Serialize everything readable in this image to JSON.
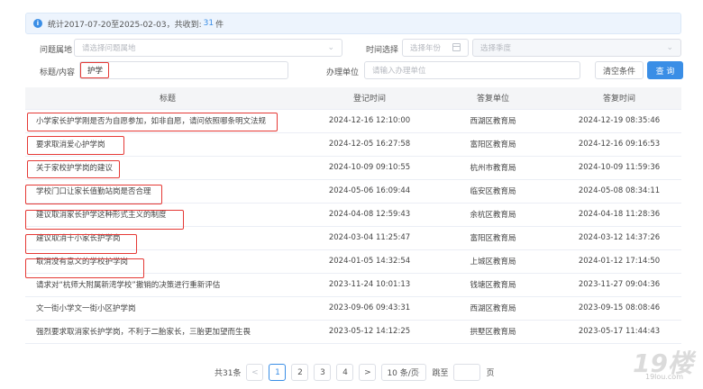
{
  "notice": {
    "prefix": "统计2017-07-20至2025-02-03，共收到:",
    "count": "31",
    "suffix": "件"
  },
  "filters": {
    "category_label": "问题属地",
    "category_placeholder": "请选择问题属地",
    "time_label": "时间选择",
    "year_placeholder": "选择年份",
    "season_placeholder": "选择季度",
    "title_label": "标题/内容",
    "title_value": "护学",
    "unit_label": "办理单位",
    "unit_placeholder": "请输入办理单位",
    "clear_label": "清空条件",
    "search_label": "查 询"
  },
  "table": {
    "headers": [
      "标题",
      "登记时间",
      "答复单位",
      "答复时间"
    ],
    "rows": [
      {
        "title": "小学家长护学刚是否为自愿参加，如非自愿，请问依照哪条明文法规",
        "reg": "2024-12-16 12:10:00",
        "unit": "西湖区教育局",
        "reply": "2024-12-19 08:35:46"
      },
      {
        "title": "要求取消爱心护学岗",
        "reg": "2024-12-05 16:27:58",
        "unit": "富阳区教育局",
        "reply": "2024-12-16 09:16:53"
      },
      {
        "title": "关于家校护学岗的建议",
        "reg": "2024-10-09 09:10:55",
        "unit": "杭州市教育局",
        "reply": "2024-10-09 11:59:36"
      },
      {
        "title": "学校门口让家长值勤站岗是否合理",
        "reg": "2024-05-06 16:09:44",
        "unit": "临安区教育局",
        "reply": "2024-05-08 08:34:11"
      },
      {
        "title": "建议取消家长护学这种形式主义的制度",
        "reg": "2024-04-08 12:59:43",
        "unit": "余杭区教育局",
        "reply": "2024-04-18 11:28:36"
      },
      {
        "title": "建议取消十小家长护学岗",
        "reg": "2024-03-04 11:25:47",
        "unit": "富阳区教育局",
        "reply": "2024-03-12 14:37:26"
      },
      {
        "title": "取消没有意义的学校护学岗",
        "reg": "2024-01-05 14:32:54",
        "unit": "上城区教育局",
        "reply": "2024-01-12 17:14:50"
      },
      {
        "title": "请求对“杭师大附属新湾学校”撤销的决策进行重新评估",
        "reg": "2023-11-24 10:01:13",
        "unit": "钱塘区教育局",
        "reply": "2023-11-27 09:04:36"
      },
      {
        "title": "文一街小学文一街小区护学岗",
        "reg": "2023-09-06 09:43:31",
        "unit": "西湖区教育局",
        "reply": "2023-09-15 08:08:46"
      },
      {
        "title": "强烈要求取消家长护学岗，不利于二胎家长，三胎更加望而生畏",
        "reg": "2023-05-12 14:12:25",
        "unit": "拱墅区教育局",
        "reply": "2023-05-17 11:44:43"
      }
    ]
  },
  "pagination": {
    "total": "共31条",
    "prev": "<",
    "pages": [
      "1",
      "2",
      "3",
      "4"
    ],
    "next": ">",
    "page_size": "10 条/页",
    "goto_label": "跳至",
    "goto_suffix": "页"
  },
  "watermark": {
    "brand": "19楼",
    "url": "19lou.com"
  },
  "colors": {
    "accent": "#3a8ee6",
    "highlight": "#e53935"
  }
}
